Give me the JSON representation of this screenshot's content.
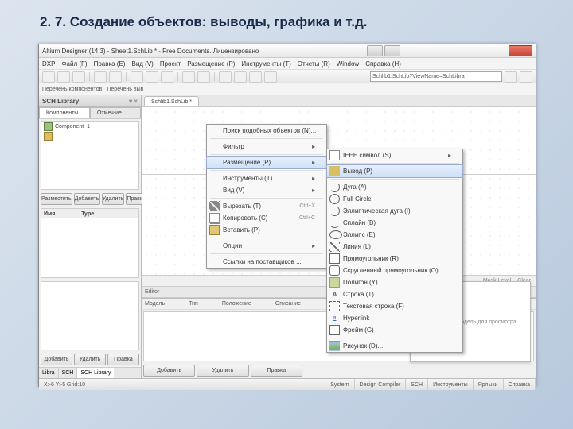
{
  "slide_title": "2. 7. Создание объектов: выводы, графика и т.д.",
  "window_title": "Altium Designer (14.3) - Sheet1.SchLib * - Free Documents. Лицензировано",
  "menubar": [
    "DXP",
    "Файл (F)",
    "Правка (E)",
    "Вид (V)",
    "Проект",
    "Размещение (P)",
    "Инструменты (T)",
    "Отчеты (R)",
    "Window",
    "Справка (H)"
  ],
  "path": "Schlib1.SchLib?ViewName=SchLibra",
  "toolbar2_items": [
    "",
    "",
    "",
    "Перечень компонентов",
    "Перечень выв"
  ],
  "left": {
    "title": "SCH Library",
    "tabs": [
      "Компоненты",
      "Отмеч-ие"
    ],
    "items": [
      {
        "icon": "g",
        "label": "Component_1"
      },
      {
        "icon": "y",
        "label": ""
      }
    ],
    "btns1": [
      "Разместить",
      "Добавить",
      "Удалить",
      "Правка"
    ],
    "grid_hdrs": [
      "Имя",
      "Type"
    ],
    "btns2": [
      "Добавить",
      "Удалить",
      "Правка"
    ],
    "footer_tabs": [
      "Libra",
      "SCH",
      "SCH Library"
    ]
  },
  "tab_label": "Schlib1.SchLib *",
  "lower": {
    "editor_label": "Editor",
    "cols": [
      "Модель",
      "Тип",
      "Положение",
      "Описание"
    ],
    "btns": [
      "Добавить",
      "Удалить",
      "Правка"
    ]
  },
  "mask": [
    "Mask Level",
    "Clear"
  ],
  "preview_msg": "Не выбрана модель для просмотра",
  "status": [
    "X:-6     Y:-5    Grid:10",
    "System",
    "Design Compiler",
    "SCH",
    "Инструменты",
    "Ярлыки",
    "Справка"
  ],
  "menu1": [
    {
      "t": "Поиск подобных объектов (N)..."
    },
    {
      "sep": 1
    },
    {
      "t": "Фильтр",
      "arrow": 1
    },
    {
      "sep": 1
    },
    {
      "t": "Размещение (P)",
      "arrow": 1,
      "hover": 1
    },
    {
      "sep": 1
    },
    {
      "t": "Инструменты (T)",
      "arrow": 1
    },
    {
      "t": "Вид (V)",
      "arrow": 1
    },
    {
      "sep": 1
    },
    {
      "t": "Вырезать (T)",
      "sc": "Ctrl+X",
      "ic": "cut"
    },
    {
      "t": "Копировать (C)",
      "sc": "Ctrl+C",
      "ic": "copy"
    },
    {
      "t": "Вставить (P)",
      "ic": "paste"
    },
    {
      "sep": 1
    },
    {
      "t": "Опции",
      "arrow": 1
    },
    {
      "sep": 1
    },
    {
      "t": "Ссылки на поставщиков ..."
    }
  ],
  "menu2": [
    {
      "t": "IEEE символ (S)",
      "arrow": 1,
      "ic": "ieee"
    },
    {
      "sep": 1
    },
    {
      "t": "Вывод (P)",
      "ic": "pin",
      "hover": 1
    },
    {
      "sep": 1
    },
    {
      "t": "Дуга (A)",
      "ic": "arc"
    },
    {
      "t": "Full Circle",
      "ic": "circ"
    },
    {
      "t": "Эллиптическая дуга (I)",
      "ic": "arc"
    },
    {
      "t": "Сплайн (B)",
      "ic": "curve"
    },
    {
      "t": "Эллипс (E)",
      "ic": "ellipse"
    },
    {
      "t": "Линия (L)",
      "ic": "line"
    },
    {
      "t": "Прямоугольник (R)",
      "ic": "rect"
    },
    {
      "t": "Скругленный прямоугольник (O)",
      "ic": "rrect"
    },
    {
      "t": "Полигон (Y)",
      "ic": "poly"
    },
    {
      "t": "Строка (T)",
      "ic": "text",
      "txt": "A"
    },
    {
      "t": "Текстовая строка (F)",
      "ic": "frame"
    },
    {
      "t": "Hyperlink",
      "ic": "link",
      "txt": "a"
    },
    {
      "t": "Фрейм (G)",
      "ic": "rect"
    },
    {
      "sep": 1
    },
    {
      "t": "Рисунок (D)...",
      "ic": "img"
    }
  ]
}
